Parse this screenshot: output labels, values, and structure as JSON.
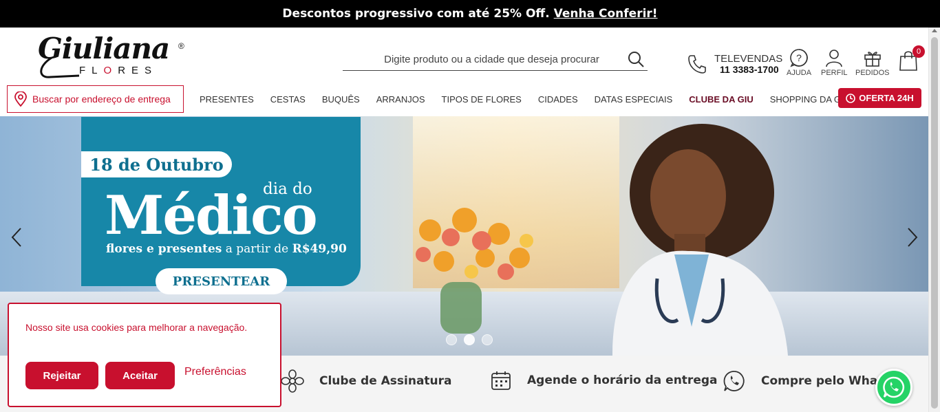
{
  "announcement": {
    "text": "Descontos progressivo com até 25% Off.",
    "link": "Venha Conferir!"
  },
  "logo": {
    "script": "Giuliana",
    "reg": "®",
    "flores_pre": "FL",
    "flores_o": "O",
    "flores_post": "RES"
  },
  "search": {
    "placeholder": "Digite produto ou a cidade que deseja procurar"
  },
  "televendas": {
    "label": "TELEVENDAS",
    "phone": "11 3383-1700"
  },
  "header_icons": {
    "help": "AJUDA",
    "profile": "PERFIL",
    "orders": "PEDIDOS",
    "cart_count": "0"
  },
  "address": {
    "label": "Buscar por endereço de entrega"
  },
  "nav": {
    "items": [
      "PRESENTES",
      "CESTAS",
      "BUQUÊS",
      "ARRANJOS",
      "TIPOS DE FLORES",
      "CIDADES",
      "DATAS ESPECIAIS",
      "CLUBE DA GIU",
      "SHOPPING DA GIU"
    ],
    "oferta": "OFERTA 24H"
  },
  "hero": {
    "date": "18 de Outubro",
    "dia_do": "dia do",
    "title": "Médico",
    "subtitle_bold": "flores e presentes",
    "subtitle_mid": " a partir de ",
    "subtitle_price": "R$49,90",
    "button": "PRESENTEAR",
    "slide_count": 3,
    "active_slide": 2
  },
  "features": {
    "club": "Clube de Assinatura",
    "schedule": "Agende o horário da entrega",
    "whats": "Compre pelo What"
  },
  "cookie": {
    "message": "Nosso site usa cookies para melhorar a navegação.",
    "reject": "Rejeitar",
    "accept": "Aceitar",
    "preferences": "Preferências"
  },
  "colors": {
    "brand_red": "#c8102e",
    "promo_blue": "#1787a8",
    "whatsapp": "#25d366"
  }
}
